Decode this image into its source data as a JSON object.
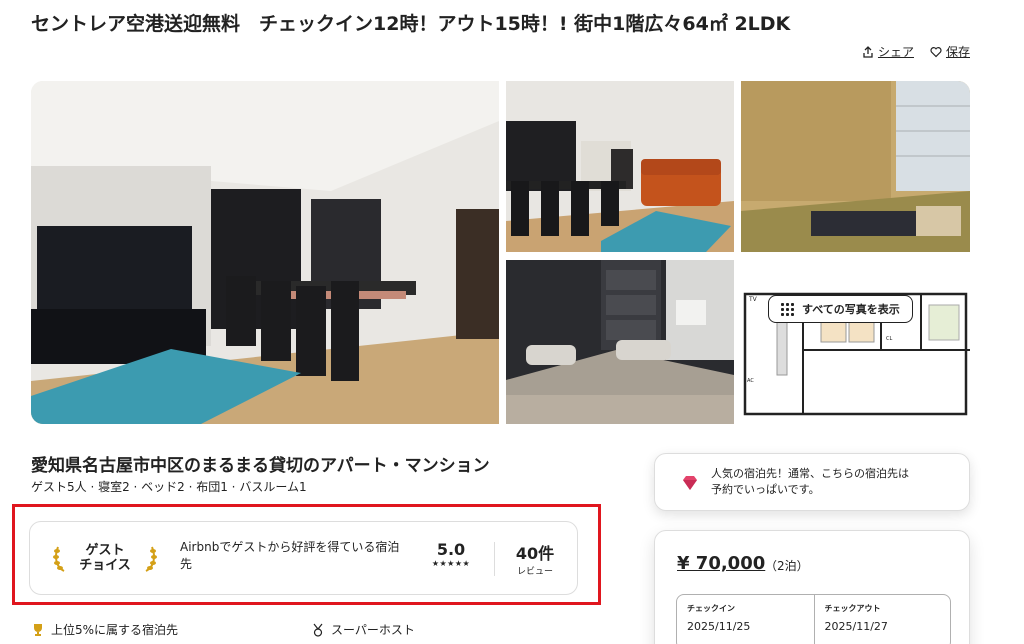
{
  "listing": {
    "title": "セントレア空港送迎無料　チェックイン12時！アウト15時！! 街中1階広々64㎡ 2LDK",
    "share_label": "シェア",
    "save_label": "保存"
  },
  "gallery": {
    "show_all_label": "すべての写真を表示",
    "photos": [
      "living-dining-room",
      "dining-and-sofa",
      "tatami-room",
      "bedroom",
      "floor-plan"
    ],
    "floorplan_labels": [
      "TV",
      "Double Bed",
      "Double Bed",
      "CL",
      "CL",
      "AC"
    ]
  },
  "details": {
    "location_title": "愛知県名古屋市中区のまるまる貸切のアパート・マンション",
    "summary": "ゲスト5人 · 寝室2 · ベッド2 · 布団1 · バスルーム1"
  },
  "guest_favorite": {
    "badge_line1": "ゲスト",
    "badge_line2": "チョイス",
    "description": "Airbnbでゲストから好評を得ている宿泊先",
    "rating": "5.0",
    "stars": "★★★★★",
    "review_count": "40件",
    "review_label": "レビュー"
  },
  "highlights": {
    "top5": "上位5%に属する宿泊先",
    "superhost": "スーパーホスト"
  },
  "rare_find": {
    "line1": "人気の宿泊先！通常、こちらの宿泊先は",
    "line2": "予約でいっぱいです。"
  },
  "booking": {
    "price": "¥ 70,000",
    "nights": "（2泊）",
    "checkin_label": "チェックイン",
    "checkin_date": "2025/11/25",
    "checkout_label": "チェックアウト",
    "checkout_date": "2025/11/27"
  },
  "colors": {
    "highlight_red": "#e0161e",
    "laurel_gold": "#d4a017",
    "gem_pink": "#e3436b"
  }
}
